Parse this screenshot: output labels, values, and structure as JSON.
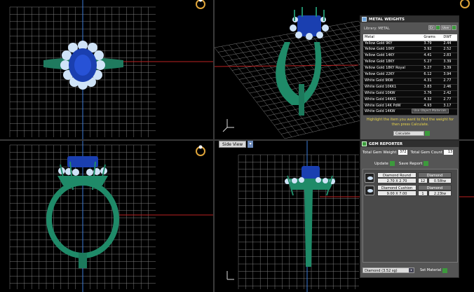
{
  "viewport_br": {
    "view_label": "Side View"
  },
  "metal_weights": {
    "title": "METAL WEIGHTS",
    "library_label": "Library: METAL",
    "library_buttons": [
      "Cr",
      "User"
    ],
    "columns": [
      "Metal",
      "Grams",
      "DWT"
    ],
    "rows": [
      [
        "Yellow Gold 9KY",
        "3.79",
        "2.44"
      ],
      [
        "Yellow Gold 10KY",
        "3.92",
        "2.52"
      ],
      [
        "Yellow Gold 14KY",
        "4.41",
        "2.83"
      ],
      [
        "Yellow Gold 18KY",
        "5.27",
        "3.39"
      ],
      [
        "Yellow Gold 18KY Royal",
        "5.27",
        "3.39"
      ],
      [
        "Yellow Gold 22KY",
        "6.12",
        "3.94"
      ],
      [
        "White Gold 9KW",
        "4.31",
        "2.77"
      ],
      [
        "White Gold 10KK1",
        "3.83",
        "2.46"
      ],
      [
        "White Gold 10KW",
        "3.76",
        "2.42"
      ],
      [
        "White Gold 14KK1",
        "4.32",
        "2.77"
      ],
      [
        "White Gold 14K PdW",
        "4.93",
        "3.17"
      ],
      [
        "White Gold 14KW",
        "",
        ""
      ]
    ],
    "use_object_label": "Use Object Materials",
    "message": "Highlight the item you want to find the weight for then press Calculate.",
    "calculate_label": "Calculate"
  },
  "gem_reporter": {
    "title": "GEM REPORTER",
    "total_weight_label": "Total Gem Weight",
    "total_weight_value": "372",
    "total_count_label": "Total Gem Count",
    "total_count_value": "13",
    "update_label": "Update",
    "save_report_label": "Save Report",
    "gems": [
      {
        "name": "Diamond Round",
        "size": "2.70 X 2.70",
        "material": "Diamond",
        "count": "12",
        "weight": "0.58tw"
      },
      {
        "name": "Diamond Cushion",
        "size": "9.00 X 7.00",
        "material": "Diamond",
        "count": "1",
        "weight": "2.23tw"
      }
    ],
    "material_select": "Diamond (3.52 sg)",
    "set_material_label": "Set Material"
  },
  "colors": {
    "metal": "#2a8c6e",
    "gem_blue": "#1a3fb0",
    "grid": "#8a8a8a"
  }
}
